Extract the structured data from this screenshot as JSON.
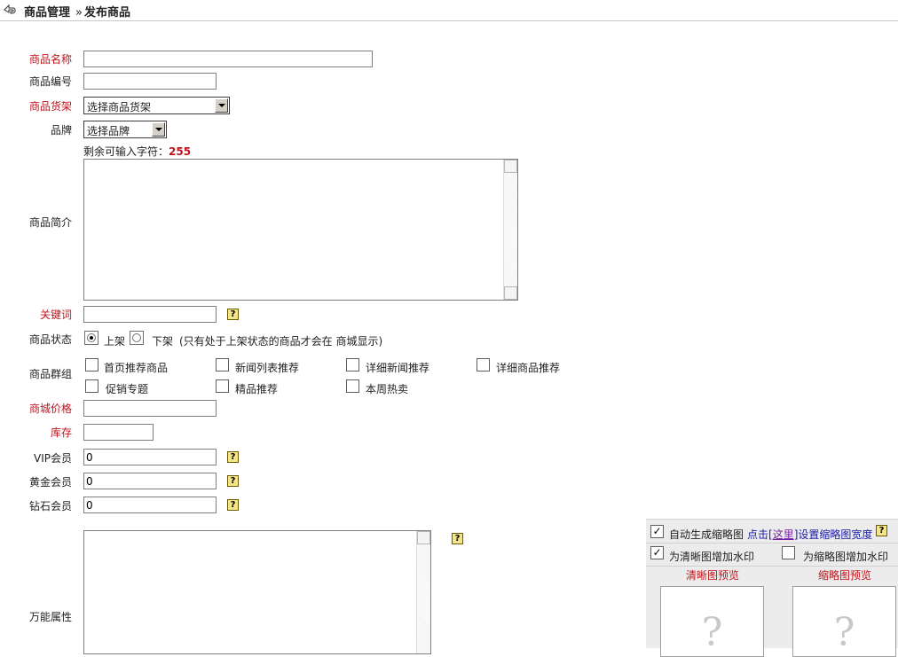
{
  "header": {
    "section": "商品管理",
    "separator": "»",
    "page": "发布商品",
    "logo_icon": "back-arrow-icon"
  },
  "form": {
    "name_label": "商品名称",
    "name_value": "",
    "code_label": "商品编号",
    "code_value": "",
    "shelf_label": "商品货架",
    "shelf_selected": "选择商品货架",
    "brand_label": "品牌",
    "brand_selected": "选择品牌",
    "remaining_label": "剩余可输入字符：",
    "remaining_count": "255",
    "intro_label": "商品简介",
    "intro_value": "",
    "keyword_label": "关键词",
    "keyword_value": "",
    "status_label": "商品状态",
    "status_on": "上架",
    "status_off": "下架",
    "status_note": "(只有处于上架状态的商品才会在 商城显示)",
    "status_selected": "上架",
    "group_label": "商品群组",
    "groups": [
      {
        "label": "首页推荐商品",
        "checked": false
      },
      {
        "label": "新闻列表推荐",
        "checked": false
      },
      {
        "label": "详细新闻推荐",
        "checked": false
      },
      {
        "label": "详细商品推荐",
        "checked": false
      },
      {
        "label": "促销专题",
        "checked": false
      },
      {
        "label": "精品推荐",
        "checked": false
      },
      {
        "label": "本周热卖",
        "checked": false
      }
    ],
    "price_label": "商城价格",
    "price_value": "",
    "stock_label": "库存",
    "stock_value": "",
    "vip_label": "VIP会员",
    "vip_value": "0",
    "gold_label": "黄金会员",
    "gold_value": "0",
    "diamond_label": "钻石会员",
    "diamond_value": "0",
    "attr_label": "万能属性",
    "attr_value": ""
  },
  "panel": {
    "auto_thumb_label": "自动生成缩略图",
    "auto_thumb_checked": true,
    "click_text": "点击[",
    "here_link": "这里",
    "set_width_text": "]设置缩略图宽度",
    "watermark_clear_label": "为清晰图增加水印",
    "watermark_clear_checked": true,
    "watermark_thumb_label": "为缩略图增加水印",
    "watermark_thumb_checked": false,
    "clear_preview_label": "清晰图预览",
    "thumb_preview_label": "缩略图预览",
    "placeholder_glyph": "?"
  },
  "help_glyph": "?",
  "check_glyph": "✓",
  "colors": {
    "required_label": "#c0141c",
    "link_blue": "#1a1aa6",
    "help_bg": "#f4e48a"
  }
}
